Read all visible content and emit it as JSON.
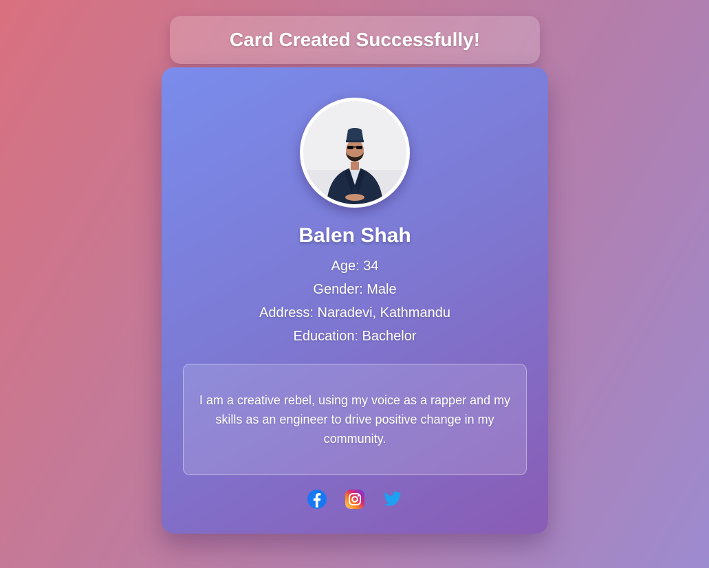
{
  "banner": {
    "message": "Card Created Successfully!"
  },
  "profile": {
    "photo_alt": "Profile photo",
    "name": "Balen Shah",
    "age_line": "Age: 34",
    "gender_line": "Gender: Male",
    "address_line": "Address: Naradevi, Kathmandu",
    "education_line": "Education: Bachelor",
    "bio": "I am a creative rebel, using my voice as a rapper and my skills as an engineer to drive positive change in my community."
  },
  "socials": [
    {
      "name": "facebook",
      "icon": "facebook-icon",
      "color": "#1877f2"
    },
    {
      "name": "instagram",
      "icon": "instagram-icon",
      "color": "#e1306c"
    },
    {
      "name": "twitter",
      "icon": "twitter-icon",
      "color": "#1da1f2"
    }
  ],
  "colors": {
    "card_gradient_start": "#7a8cec",
    "card_gradient_end": "#8a5cb5",
    "background_start": "#d9707f",
    "background_end": "#9d8bd0"
  }
}
